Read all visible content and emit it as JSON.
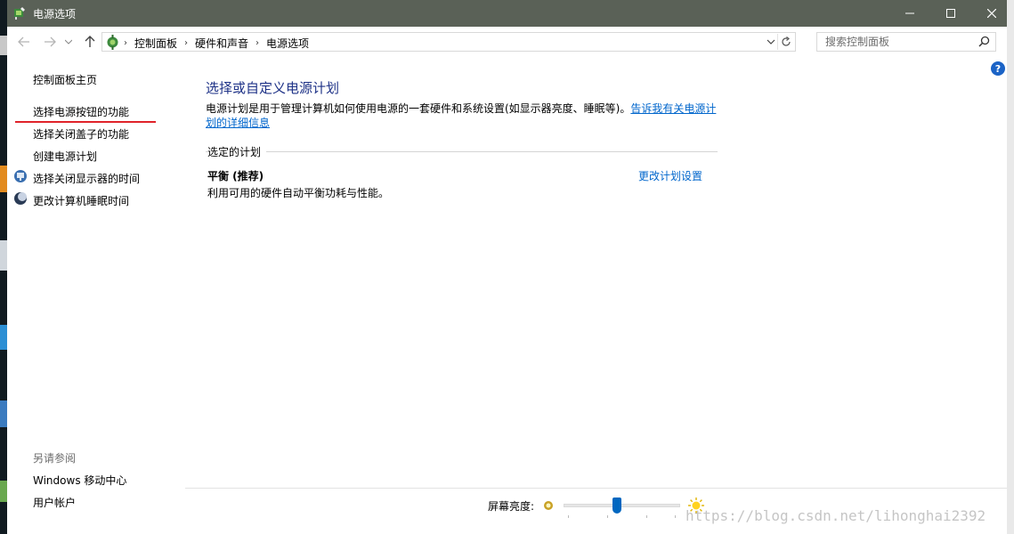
{
  "window": {
    "title": "电源选项",
    "colors": {
      "titlebar": "#5a6157",
      "link": "#0066cc",
      "heading": "#1e3287",
      "annotation": "#e0232a"
    }
  },
  "nav": {
    "breadcrumbs": [
      "控制面板",
      "硬件和声音",
      "电源选项"
    ],
    "search_placeholder": "搜索控制面板"
  },
  "left_pane": {
    "home": "控制面板主页",
    "links": [
      "选择电源按钮的功能",
      "选择关闭盖子的功能",
      "创建电源计划",
      "选择关闭显示器的时间",
      "更改计算机睡眠时间"
    ],
    "see_also_title": "另请参阅",
    "see_also": [
      "Windows 移动中心",
      "用户帐户"
    ]
  },
  "main": {
    "heading": "选择或自定义电源计划",
    "description": "电源计划是用于管理计算机如何使用电源的一套硬件和系统设置(如显示器亮度、睡眠等)。",
    "description_link": "告诉我有关电源计划的详细信息",
    "group_label": "选定的计划",
    "plan": {
      "name": "平衡 (推荐)",
      "description": "利用可用的硬件自动平衡功耗与性能。",
      "change_link": "更改计划设置"
    }
  },
  "bottom": {
    "brightness_label": "屏幕亮度:",
    "brightness_value": 0.45
  },
  "watermark": "https://blog.csdn.net/lihonghai2392"
}
